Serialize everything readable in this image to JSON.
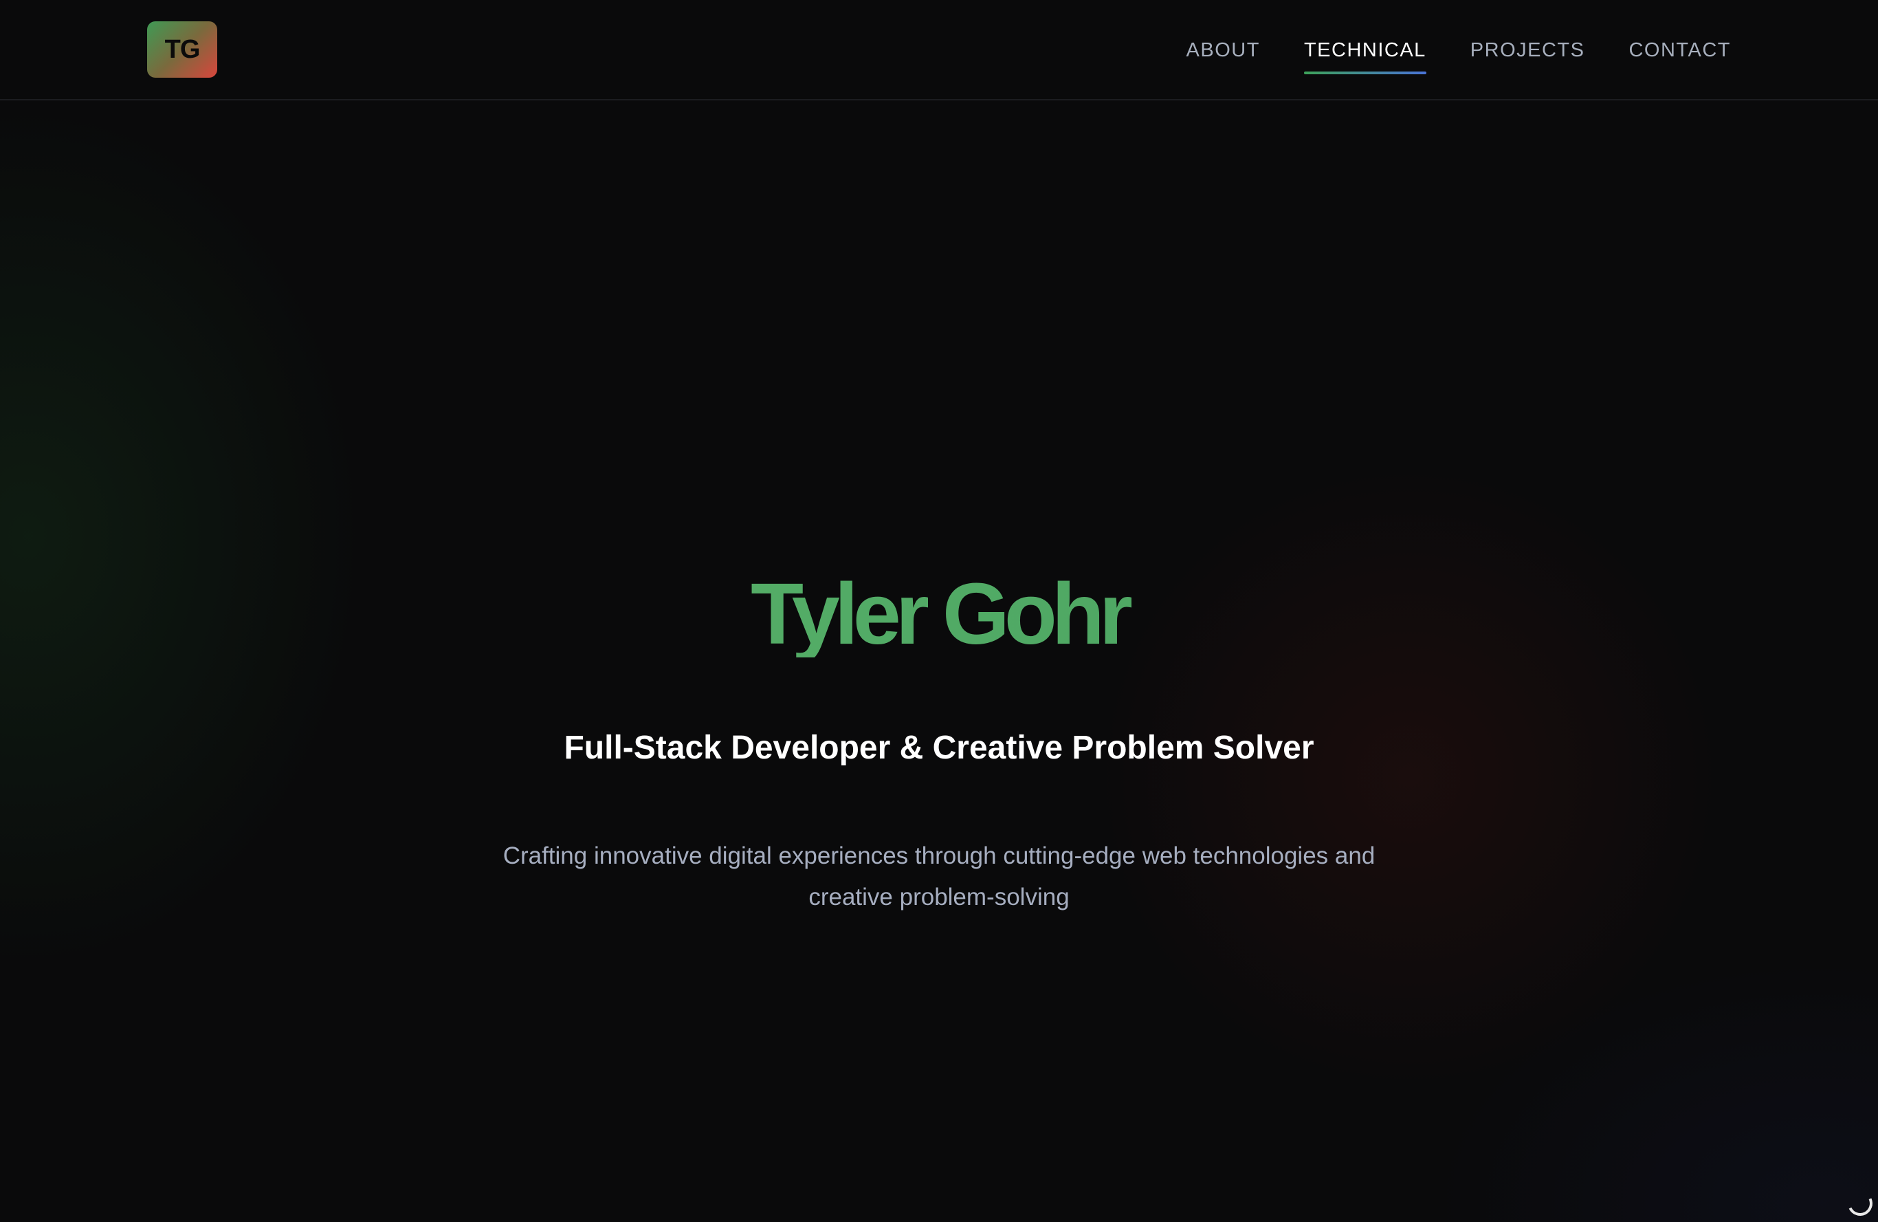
{
  "header": {
    "logo_text": "TG",
    "nav": [
      {
        "label": "ABOUT",
        "active": false
      },
      {
        "label": "TECHNICAL",
        "active": true
      },
      {
        "label": "PROJECTS",
        "active": false
      },
      {
        "label": "CONTACT",
        "active": false
      }
    ]
  },
  "hero": {
    "name": "Tyler Gohr",
    "title": "Full-Stack Developer & Creative Problem Solver",
    "description": "Crafting innovative digital experiences through cutting-edge web technologies and creative problem-solving"
  },
  "colors": {
    "background": "#0a0a0b",
    "accent_green": "#4fa864",
    "accent_red": "#d8463d",
    "accent_blue": "#4a74d8",
    "nav_text": "#a7afbd"
  },
  "icons": {
    "loader": "loading-spinner-icon"
  }
}
